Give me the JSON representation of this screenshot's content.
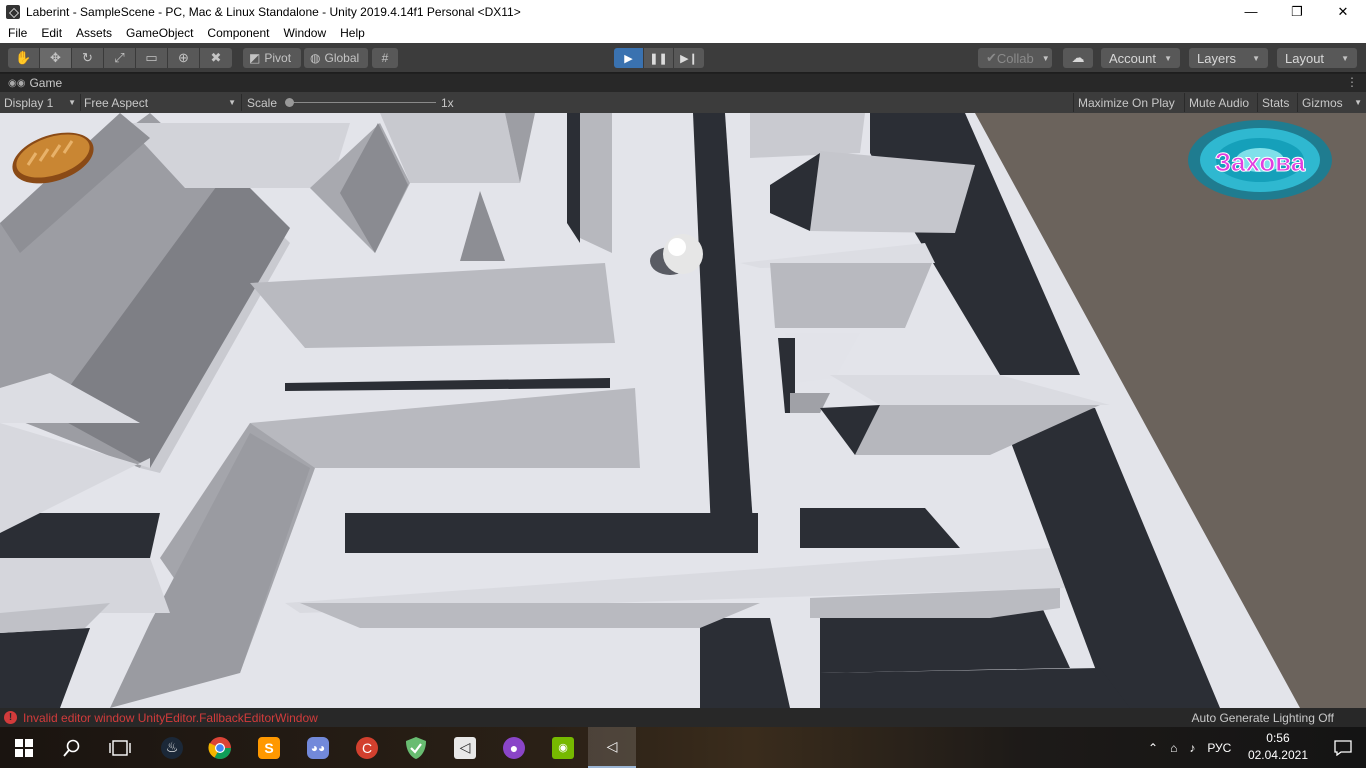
{
  "window": {
    "title": "Laberint - SampleScene - PC, Mac & Linux Standalone - Unity 2019.4.14f1 Personal <DX11>",
    "minimize_glyph": "—",
    "maximize_glyph": "❐",
    "close_glyph": "✕"
  },
  "menu": [
    "File",
    "Edit",
    "Assets",
    "GameObject",
    "Component",
    "Window",
    "Help"
  ],
  "toolbar": {
    "tools": [
      {
        "name": "hand-tool",
        "glyph": "✋"
      },
      {
        "name": "move-tool",
        "glyph": "✥"
      },
      {
        "name": "rotate-tool",
        "glyph": "↻"
      },
      {
        "name": "scale-tool",
        "glyph": "⤢"
      },
      {
        "name": "rect-tool",
        "glyph": "▭"
      },
      {
        "name": "transform-tool",
        "glyph": "⊕"
      },
      {
        "name": "custom-tool",
        "glyph": "✖"
      }
    ],
    "pivot_label": "Pivot",
    "global_label": "Global",
    "collab_label": "Collab",
    "account_label": "Account",
    "layers_label": "Layers",
    "layout_label": "Layout"
  },
  "game_tab": {
    "label": "Game"
  },
  "game_bar": {
    "display": "Display 1",
    "aspect": "Free Aspect",
    "scale_label": "Scale",
    "scale_value": "1x",
    "maximize_on_play": "Maximize On Play",
    "mute_audio": "Mute Audio",
    "stats": "Stats",
    "gizmos": "Gizmos"
  },
  "game_hud": {
    "logo_text": "Захова"
  },
  "status": {
    "error_text": "Invalid editor window UnityEditor.FallbackEditorWindow",
    "lighting_text": "Auto Generate Lighting Off"
  },
  "taskbar": {
    "apps": [
      "windows-start",
      "search",
      "task-view",
      "steam",
      "chrome",
      "sublime-text",
      "discord",
      "ccleaner",
      "adguard",
      "unity-hub",
      "github-desktop",
      "nvidia",
      "unity-editor"
    ],
    "language": "РУС",
    "time": "0:56",
    "date": "02.04.2021"
  },
  "colors": {
    "play_active": "#3a72b0",
    "editor_bg": "#3c3c3c",
    "error": "#d23b3b",
    "maze_floor": "#e2e3ea",
    "maze_path": "#2c2f36"
  }
}
